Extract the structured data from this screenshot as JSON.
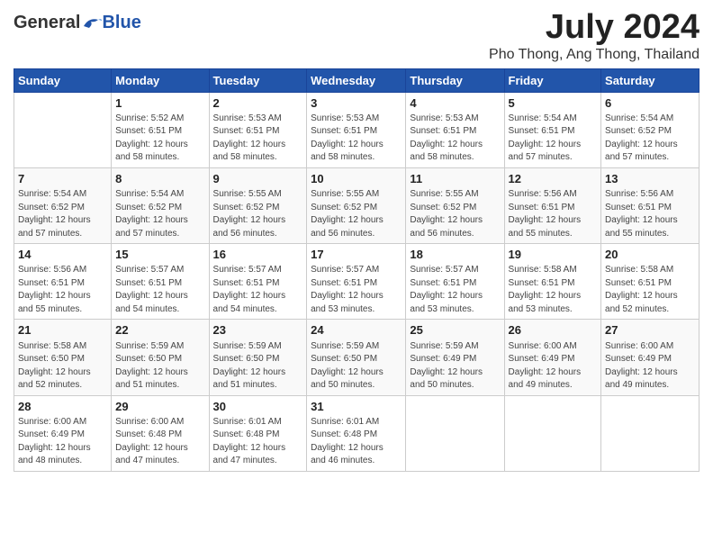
{
  "logo": {
    "general": "General",
    "blue": "Blue"
  },
  "title": "July 2024",
  "location": "Pho Thong, Ang Thong, Thailand",
  "days_of_week": [
    "Sunday",
    "Monday",
    "Tuesday",
    "Wednesday",
    "Thursday",
    "Friday",
    "Saturday"
  ],
  "weeks": [
    [
      {
        "day": "",
        "info": ""
      },
      {
        "day": "1",
        "info": "Sunrise: 5:52 AM\nSunset: 6:51 PM\nDaylight: 12 hours\nand 58 minutes."
      },
      {
        "day": "2",
        "info": "Sunrise: 5:53 AM\nSunset: 6:51 PM\nDaylight: 12 hours\nand 58 minutes."
      },
      {
        "day": "3",
        "info": "Sunrise: 5:53 AM\nSunset: 6:51 PM\nDaylight: 12 hours\nand 58 minutes."
      },
      {
        "day": "4",
        "info": "Sunrise: 5:53 AM\nSunset: 6:51 PM\nDaylight: 12 hours\nand 58 minutes."
      },
      {
        "day": "5",
        "info": "Sunrise: 5:54 AM\nSunset: 6:51 PM\nDaylight: 12 hours\nand 57 minutes."
      },
      {
        "day": "6",
        "info": "Sunrise: 5:54 AM\nSunset: 6:52 PM\nDaylight: 12 hours\nand 57 minutes."
      }
    ],
    [
      {
        "day": "7",
        "info": "Sunrise: 5:54 AM\nSunset: 6:52 PM\nDaylight: 12 hours\nand 57 minutes."
      },
      {
        "day": "8",
        "info": "Sunrise: 5:54 AM\nSunset: 6:52 PM\nDaylight: 12 hours\nand 57 minutes."
      },
      {
        "day": "9",
        "info": "Sunrise: 5:55 AM\nSunset: 6:52 PM\nDaylight: 12 hours\nand 56 minutes."
      },
      {
        "day": "10",
        "info": "Sunrise: 5:55 AM\nSunset: 6:52 PM\nDaylight: 12 hours\nand 56 minutes."
      },
      {
        "day": "11",
        "info": "Sunrise: 5:55 AM\nSunset: 6:52 PM\nDaylight: 12 hours\nand 56 minutes."
      },
      {
        "day": "12",
        "info": "Sunrise: 5:56 AM\nSunset: 6:51 PM\nDaylight: 12 hours\nand 55 minutes."
      },
      {
        "day": "13",
        "info": "Sunrise: 5:56 AM\nSunset: 6:51 PM\nDaylight: 12 hours\nand 55 minutes."
      }
    ],
    [
      {
        "day": "14",
        "info": "Sunrise: 5:56 AM\nSunset: 6:51 PM\nDaylight: 12 hours\nand 55 minutes."
      },
      {
        "day": "15",
        "info": "Sunrise: 5:57 AM\nSunset: 6:51 PM\nDaylight: 12 hours\nand 54 minutes."
      },
      {
        "day": "16",
        "info": "Sunrise: 5:57 AM\nSunset: 6:51 PM\nDaylight: 12 hours\nand 54 minutes."
      },
      {
        "day": "17",
        "info": "Sunrise: 5:57 AM\nSunset: 6:51 PM\nDaylight: 12 hours\nand 53 minutes."
      },
      {
        "day": "18",
        "info": "Sunrise: 5:57 AM\nSunset: 6:51 PM\nDaylight: 12 hours\nand 53 minutes."
      },
      {
        "day": "19",
        "info": "Sunrise: 5:58 AM\nSunset: 6:51 PM\nDaylight: 12 hours\nand 53 minutes."
      },
      {
        "day": "20",
        "info": "Sunrise: 5:58 AM\nSunset: 6:51 PM\nDaylight: 12 hours\nand 52 minutes."
      }
    ],
    [
      {
        "day": "21",
        "info": "Sunrise: 5:58 AM\nSunset: 6:50 PM\nDaylight: 12 hours\nand 52 minutes."
      },
      {
        "day": "22",
        "info": "Sunrise: 5:59 AM\nSunset: 6:50 PM\nDaylight: 12 hours\nand 51 minutes."
      },
      {
        "day": "23",
        "info": "Sunrise: 5:59 AM\nSunset: 6:50 PM\nDaylight: 12 hours\nand 51 minutes."
      },
      {
        "day": "24",
        "info": "Sunrise: 5:59 AM\nSunset: 6:50 PM\nDaylight: 12 hours\nand 50 minutes."
      },
      {
        "day": "25",
        "info": "Sunrise: 5:59 AM\nSunset: 6:49 PM\nDaylight: 12 hours\nand 50 minutes."
      },
      {
        "day": "26",
        "info": "Sunrise: 6:00 AM\nSunset: 6:49 PM\nDaylight: 12 hours\nand 49 minutes."
      },
      {
        "day": "27",
        "info": "Sunrise: 6:00 AM\nSunset: 6:49 PM\nDaylight: 12 hours\nand 49 minutes."
      }
    ],
    [
      {
        "day": "28",
        "info": "Sunrise: 6:00 AM\nSunset: 6:49 PM\nDaylight: 12 hours\nand 48 minutes."
      },
      {
        "day": "29",
        "info": "Sunrise: 6:00 AM\nSunset: 6:48 PM\nDaylight: 12 hours\nand 47 minutes."
      },
      {
        "day": "30",
        "info": "Sunrise: 6:01 AM\nSunset: 6:48 PM\nDaylight: 12 hours\nand 47 minutes."
      },
      {
        "day": "31",
        "info": "Sunrise: 6:01 AM\nSunset: 6:48 PM\nDaylight: 12 hours\nand 46 minutes."
      },
      {
        "day": "",
        "info": ""
      },
      {
        "day": "",
        "info": ""
      },
      {
        "day": "",
        "info": ""
      }
    ]
  ]
}
